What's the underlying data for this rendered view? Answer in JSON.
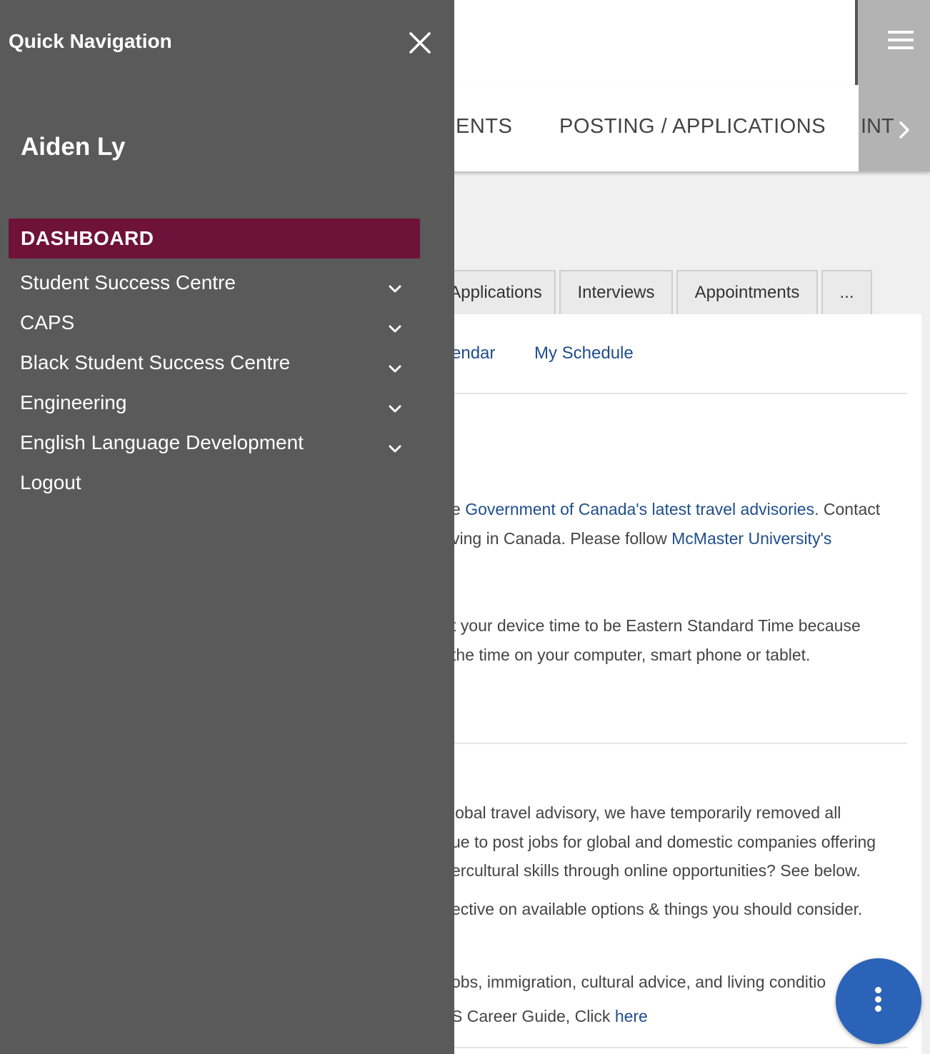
{
  "header": {
    "menu_icon": "hamburger-icon"
  },
  "nav": {
    "items": [
      "ENTS",
      "POSTING / APPLICATIONS"
    ],
    "partial_item": "INT",
    "more_icon": "chevron-right-icon"
  },
  "tabs": [
    "Applications",
    "Interviews",
    "Appointments",
    "..."
  ],
  "sublinks": [
    "endar",
    "My Schedule"
  ],
  "content": {
    "p1_a": "e ",
    "p1_link": "Government of Canada's latest travel advisories",
    "p1_b": ". Contact",
    "p2_a": "ving in Canada. Please follow ",
    "p2_link": "McMaster University's",
    "p3": "t your device time to be Eastern Standard Time because",
    "p4": "the time on your computer, smart phone or tablet.",
    "p5": "lobal travel advisory, we have temporarily removed all",
    "p6": "ue to post jobs for global and domestic companies offering",
    "p7": "ercultural skills through online opportunities? See below.",
    "p8": "ective on available options & things you should consider.",
    "p9": "obs, immigration, cultural advice, and living conditio",
    "p10_a": "S Career Guide, Click ",
    "p10_link": "here"
  },
  "fab": {
    "icon": "more-vertical-icon"
  },
  "drawer": {
    "title": "Quick Navigation",
    "close_icon": "close-icon",
    "user_name": "Aiden Ly",
    "active_item": "DASHBOARD",
    "items": [
      {
        "label": "Student Success Centre",
        "expandable": true
      },
      {
        "label": "CAPS",
        "expandable": true
      },
      {
        "label": "Black Student Success Centre",
        "expandable": true
      },
      {
        "label": "Engineering",
        "expandable": true
      },
      {
        "label": "English Language Development",
        "expandable": true
      },
      {
        "label": "Logout",
        "expandable": false
      }
    ]
  },
  "colors": {
    "drawer_bg": "#5a5a5a",
    "active_item_bg": "#6e1239",
    "link": "#1f4e8c",
    "fab": "#2a63b7"
  }
}
